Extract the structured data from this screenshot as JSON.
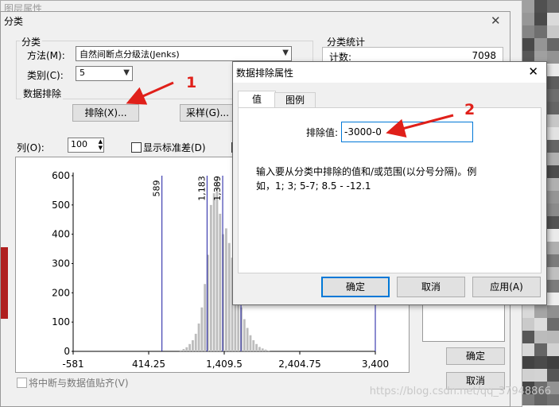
{
  "outer_window": {
    "title": "图层属性"
  },
  "classify_dialog": {
    "title": "分类",
    "classification_group": "分类",
    "method_label": "方法(M):",
    "method_value": "自然间断点分级法(Jenks)",
    "classes_label": "类别(C):",
    "classes_value": "5",
    "data_exclusion_group": "数据排除",
    "exclude_button": "排除(X)...",
    "sampling_button": "采样(G)...",
    "columns_label": "列(O):",
    "columns_value": "100",
    "show_std_label": "显示标准差(D)",
    "stats_group": "分类统计",
    "count_label": "计数:",
    "count_value": "7098",
    "snap_label": "将中断与数据值贴齐(V)",
    "ok_button": "确定",
    "cancel_button": "取消"
  },
  "chart_data": {
    "type": "bar",
    "title": "",
    "xlabel": "",
    "ylabel": "",
    "ylim": [
      0,
      600
    ],
    "xlim": [
      -581,
      3400
    ],
    "y_ticks": [
      "600",
      "500",
      "400",
      "300",
      "200",
      "100",
      "0"
    ],
    "x_ticks": [
      "-581",
      "414.25",
      "1,409.5",
      "2,404.75",
      "3,400"
    ],
    "break_lines": [
      {
        "label": "589",
        "x": 589
      },
      {
        "label": "1,183",
        "x": 1183
      },
      {
        "label": "1,389",
        "x": 1389
      },
      {
        "label": "",
        "x": 1630
      },
      {
        "label": "",
        "x": 3400
      }
    ],
    "bins_x": [
      840,
      880,
      920,
      960,
      1000,
      1040,
      1080,
      1120,
      1160,
      1200,
      1240,
      1280,
      1320,
      1360,
      1400,
      1440,
      1480,
      1520,
      1560,
      1600,
      1640,
      1680,
      1720,
      1760,
      1800,
      1840,
      1880,
      1920,
      1960,
      2000
    ],
    "bins_y": [
      4,
      8,
      14,
      25,
      38,
      60,
      95,
      150,
      230,
      330,
      500,
      540,
      590,
      470,
      400,
      420,
      370,
      320,
      230,
      180,
      150,
      110,
      80,
      55,
      38,
      25,
      15,
      10,
      6,
      3
    ]
  },
  "exclusion_dialog": {
    "title": "数据排除属性",
    "tab_values": "值",
    "tab_legend": "图例",
    "exclude_value_label": "排除值:",
    "exclude_value": "-3000-0",
    "help_text": "输入要从分类中排除的值和/或范围(以分号分隔)。例如，1; 3; 5-7; 8.5 - -12.1",
    "ok_button": "确定",
    "cancel_button": "取消",
    "apply_button": "应用(A)"
  },
  "annotations": {
    "marker1": "1",
    "marker2": "2",
    "color": "#e0201a"
  },
  "watermark": "https://blog.csdn.net/qq_37948866"
}
